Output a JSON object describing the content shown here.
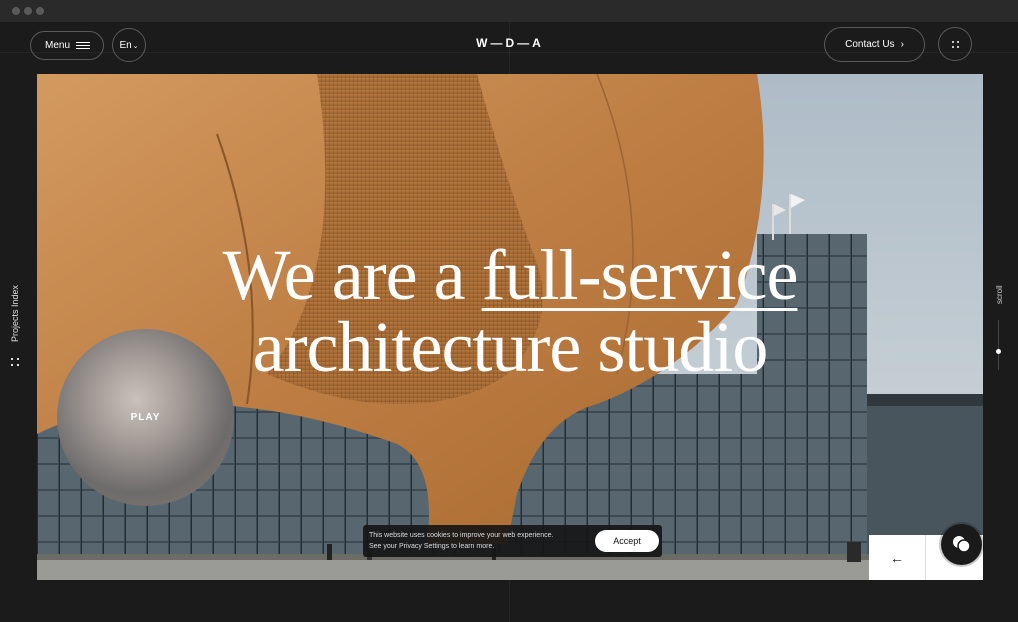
{
  "header": {
    "menu_label": "Menu",
    "lang_label": "En",
    "logo_text": "W—D—A",
    "contact_label": "Contact Us"
  },
  "side": {
    "projects_index_label": "Projects Index",
    "scroll_label": "scroll"
  },
  "hero": {
    "headline_line1_part1": "We are a ",
    "headline_line1_underlined": "full-service",
    "headline_line2": "architecture studio",
    "play_label": "PLAY"
  },
  "cookie": {
    "line1": "This website uses cookies to improve your web experience.",
    "line2": "See your Privacy Settings to learn more.",
    "accept_label": "Accept"
  },
  "colors": {
    "background": "#1b1b1b",
    "wood": "#c8884d",
    "sky": "#b7c3cc"
  },
  "icons": {
    "menu": "hamburger-icon",
    "lang": "chevron-down-icon",
    "contact": "chevron-right-icon",
    "dots": "grid-dots-icon",
    "projects": "grid-dots-icon",
    "nav_prev": "arrow-left-icon",
    "chat": "chat-bubble-icon"
  }
}
